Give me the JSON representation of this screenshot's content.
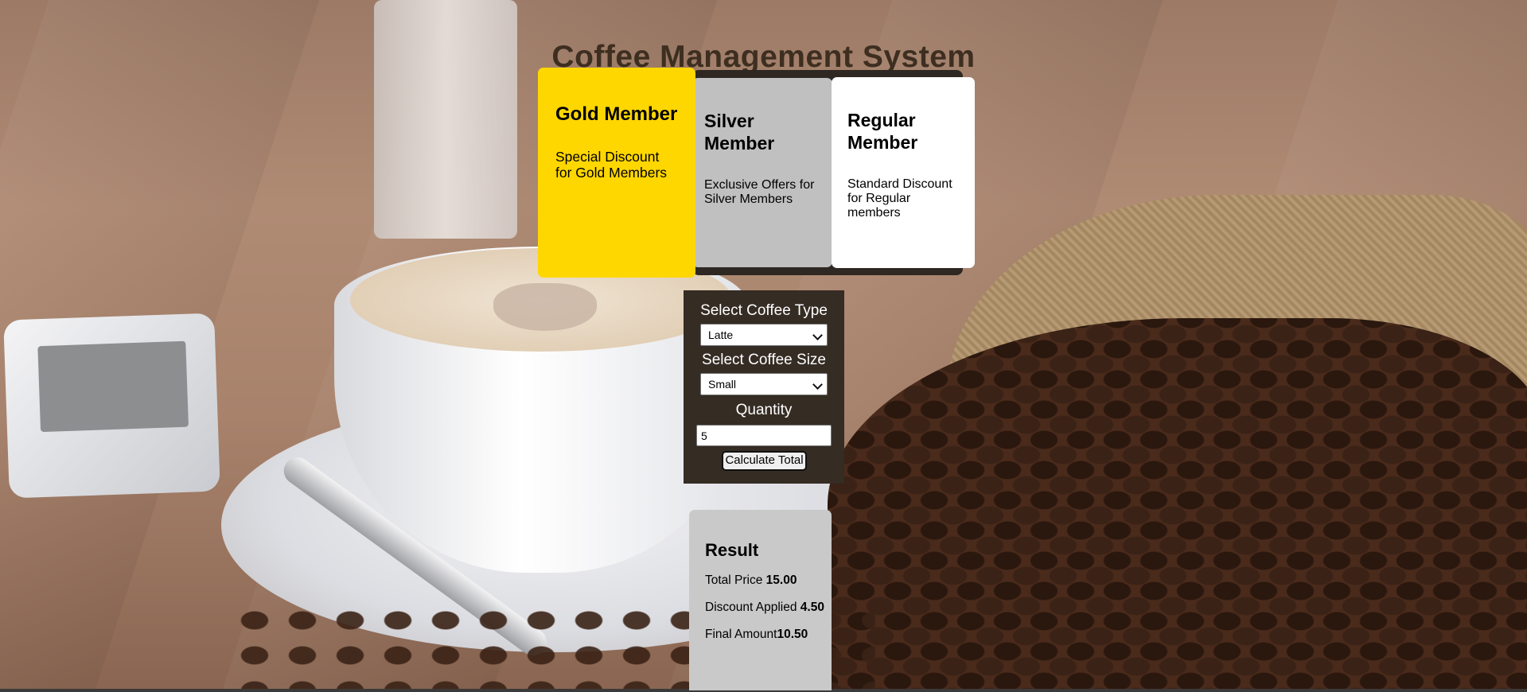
{
  "page": {
    "title": "Coffee Management System"
  },
  "memberships": [
    {
      "name": "Gold Member",
      "description": "Special Discount for Gold Members",
      "color": "#ffd700"
    },
    {
      "name": "Silver Member",
      "description": "Exclusive Offers for Silver Members",
      "color": "#c0c0c0"
    },
    {
      "name": "Regular Member",
      "description": "Standard Discount for Regular members",
      "color": "#ffffff"
    }
  ],
  "order_form": {
    "coffee_type_label": "Select Coffee Type",
    "coffee_type_value": "Latte",
    "coffee_size_label": "Select Coffee Size",
    "coffee_size_value": "Small",
    "quantity_label": "Quantity",
    "quantity_value": "5",
    "calculate_label": "Calculate Total",
    "background": "#352c24"
  },
  "result": {
    "heading": "Result",
    "total_price_label": "Total Price ",
    "total_price_value": "15.00",
    "discount_label": "Discount Applied ",
    "discount_value": "4.50",
    "final_amount_label": "Final Amount",
    "final_amount_value": "10.50",
    "background": "#c9c9c9"
  },
  "colors": {
    "title_text": "#3d2e20",
    "members_strip": "#2f2822"
  }
}
